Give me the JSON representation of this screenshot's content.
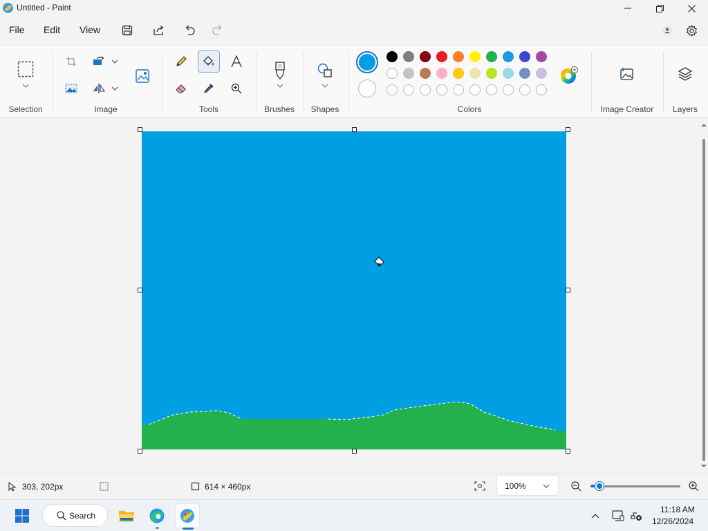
{
  "window": {
    "title": "Untitled - Paint"
  },
  "menu": {
    "file": "File",
    "edit": "Edit",
    "view": "View"
  },
  "ribbon": {
    "groups": {
      "selection": "Selection",
      "image": "Image",
      "tools": "Tools",
      "brushes": "Brushes",
      "shapes": "Shapes",
      "colors": "Colors",
      "image_creator": "Image Creator",
      "layers": "Layers"
    },
    "active_tool": "fill",
    "primary_color": "#009ee3",
    "secondary_color": "#ffffff",
    "palette_row1": [
      "#000000",
      "#7f7f7f",
      "#880015",
      "#ed1c24",
      "#ff7f27",
      "#fff200",
      "#22b14c",
      "#1e9be0",
      "#3f48cc",
      "#a349a4"
    ],
    "palette_row2": [
      "#ffffff",
      "#c3c3c3",
      "#b97a57",
      "#ffaec9",
      "#ffc90e",
      "#efe4b0",
      "#b5e61d",
      "#99d9ea",
      "#7092be",
      "#c8bfe7"
    ]
  },
  "canvas": {
    "sky_color": "#009ee3",
    "ground_color": "#22b14c"
  },
  "status": {
    "cursor_position": "303, 202px",
    "canvas_size": "614 × 460px",
    "zoom": "100%",
    "zoom_fraction": 0.1
  },
  "taskbar": {
    "search_label": "Search",
    "time": "11:18 AM",
    "date": "12/26/2024"
  }
}
